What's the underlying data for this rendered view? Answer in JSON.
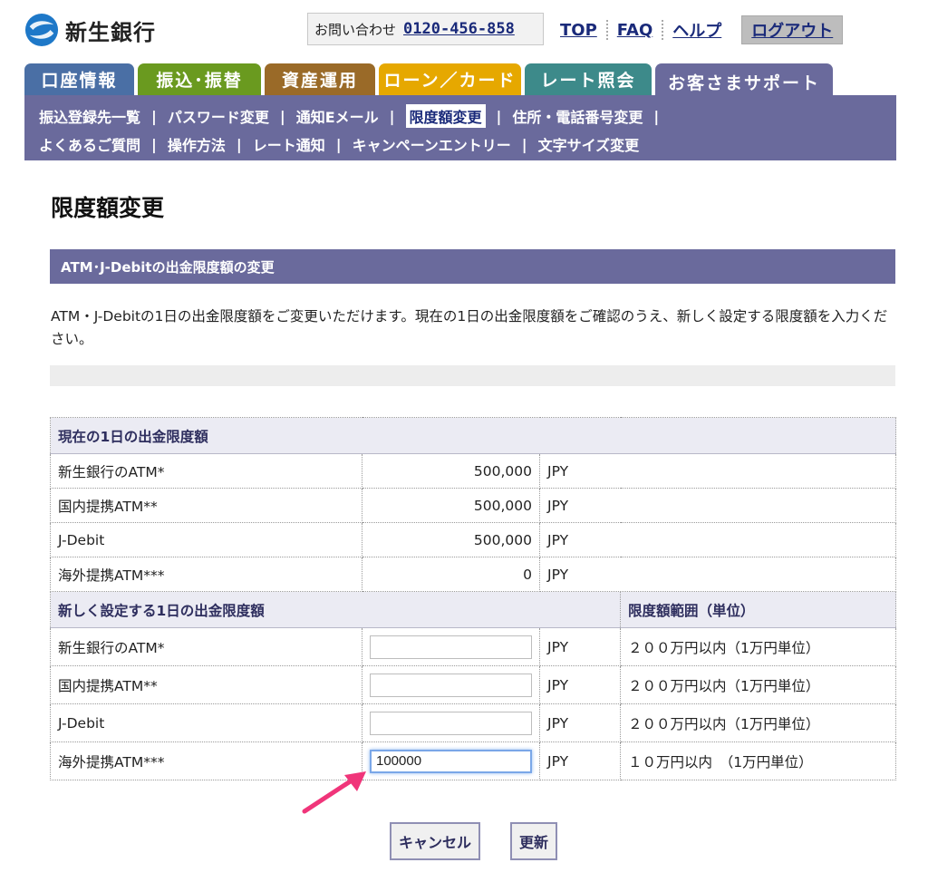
{
  "brand": {
    "name": "新生銀行",
    "logo_icon": "shinsei-logo-icon"
  },
  "header": {
    "contact_label": "お問い合わせ",
    "contact_phone": "0120-456-858",
    "links": {
      "top": "TOP",
      "faq": "FAQ",
      "help": "ヘルプ"
    },
    "logout": "ログアウト"
  },
  "tabs": [
    {
      "label": "口座情報",
      "color": "#4a6fa5"
    },
    {
      "label": "振込･振替",
      "color": "#6a9a1f"
    },
    {
      "label": "資産運用",
      "color": "#9a6a28"
    },
    {
      "label": "ローン／カード",
      "color": "#e6a800"
    },
    {
      "label": "レート照会",
      "color": "#3d8a8a"
    },
    {
      "label": "お客さまサポート",
      "color": "#6a6a9c",
      "active": true
    }
  ],
  "subnav": {
    "row1": [
      "振込登録先一覧",
      "パスワード変更",
      "通知Eメール",
      "限度額変更",
      "住所・電話番号変更"
    ],
    "row2": [
      "よくあるご質問",
      "操作方法",
      "レート通知",
      "キャンペーンエントリー",
      "文字サイズ変更"
    ],
    "current": "限度額変更"
  },
  "page": {
    "title": "限度額変更",
    "section_title": "ATM･J-Debitの出金限度額の変更",
    "description": "ATM・J-Debitの1日の出金限度額をご変更いただけます。現在の1日の出金限度額をご確認のうえ、新しく設定する限度額を入力ください。"
  },
  "current_limits": {
    "header": "現在の1日の出金限度額",
    "rows": [
      {
        "label": "新生銀行のATM*",
        "amount": "500,000",
        "currency": "JPY"
      },
      {
        "label": "国内提携ATM**",
        "amount": "500,000",
        "currency": "JPY"
      },
      {
        "label": "J-Debit",
        "amount": "500,000",
        "currency": "JPY"
      },
      {
        "label": "海外提携ATM***",
        "amount": "0",
        "currency": "JPY"
      }
    ]
  },
  "new_limits": {
    "header": "新しく設定する1日の出金限度額",
    "range_header": "限度額範囲（単位）",
    "rows": [
      {
        "label": "新生銀行のATM*",
        "value": "",
        "currency": "JPY",
        "range": "２００万円以内（1万円単位）"
      },
      {
        "label": "国内提携ATM**",
        "value": "",
        "currency": "JPY",
        "range": "２００万円以内（1万円単位）"
      },
      {
        "label": "J-Debit",
        "value": "",
        "currency": "JPY",
        "range": "２００万円以内（1万円単位）"
      },
      {
        "label": "海外提携ATM***",
        "value": "100000",
        "currency": "JPY",
        "range": "１０万円以内　（1万円単位）"
      }
    ]
  },
  "buttons": {
    "cancel": "キャンセル",
    "update": "更新"
  },
  "annotation": {
    "arrow_color": "#f0357a"
  }
}
